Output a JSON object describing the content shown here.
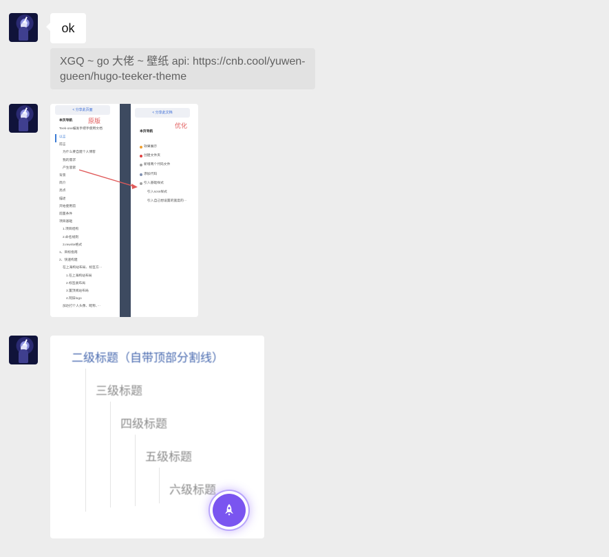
{
  "messages": [
    {
      "type": "text",
      "text": "ok"
    },
    {
      "type": "quote",
      "text": "XGQ ~ go 大佬 ~ 壁纸 api: https://cnb.cool/yuwen-gueen/hugo-teeker-theme"
    },
    {
      "type": "image",
      "left_panel": {
        "button": "< 分享此页面",
        "title": "本页导航",
        "label": "原版",
        "subtitle": "Teek-one编发手把手使用文档",
        "items": [
          "以言",
          "前言",
          "为什么要自建个人博客",
          "我的需求",
          "产生思索",
          "背景",
          "简介",
          "亮点",
          "描述",
          "开始使用前",
          "前置条件",
          "项目基础",
          "1.项目结构",
          "2.命名规则",
          "3.rewrite格式",
          "1、目标指南",
          "2、快速构建",
          "在上海构站布局、标签方···",
          "1.在上海构站布局",
          "2.标签类布局",
          "3.置顶阅站布局",
          "4.阿旧logo",
          "加达打个人头像、昵称、···"
        ]
      },
      "right_panel": {
        "button": "< 分享此文档",
        "title": "本页导航",
        "label": "优化",
        "items": [
          "效果展示",
          "创建文件夹",
          "新增两个代码文件",
          "添加代码",
          "引入基础样式",
          "引入scss样式",
          "引入自己想设置的宽度的···"
        ]
      }
    },
    {
      "type": "image",
      "headings": [
        "二级标题（自带顶部分割线）",
        "三级标题",
        "四级标题",
        "五级标题",
        "六级标题"
      ],
      "fab_icon": "rocket-icon"
    }
  ],
  "colors": {
    "background": "#ededed",
    "bubble": "#ffffff",
    "quote_bg": "#e2e2e2",
    "fab": "#7a55f0",
    "arrow": "#e05a5a"
  }
}
